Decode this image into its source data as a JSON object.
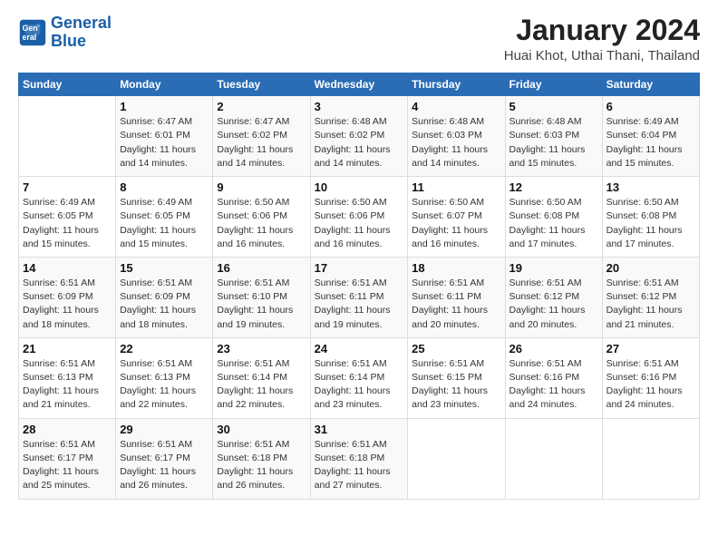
{
  "logo": {
    "line1": "General",
    "line2": "Blue"
  },
  "title": "January 2024",
  "subtitle": "Huai Khot, Uthai Thani, Thailand",
  "weekdays": [
    "Sunday",
    "Monday",
    "Tuesday",
    "Wednesday",
    "Thursday",
    "Friday",
    "Saturday"
  ],
  "weeks": [
    [
      {
        "day": "",
        "info": ""
      },
      {
        "day": "1",
        "info": "Sunrise: 6:47 AM\nSunset: 6:01 PM\nDaylight: 11 hours\nand 14 minutes."
      },
      {
        "day": "2",
        "info": "Sunrise: 6:47 AM\nSunset: 6:02 PM\nDaylight: 11 hours\nand 14 minutes."
      },
      {
        "day": "3",
        "info": "Sunrise: 6:48 AM\nSunset: 6:02 PM\nDaylight: 11 hours\nand 14 minutes."
      },
      {
        "day": "4",
        "info": "Sunrise: 6:48 AM\nSunset: 6:03 PM\nDaylight: 11 hours\nand 14 minutes."
      },
      {
        "day": "5",
        "info": "Sunrise: 6:48 AM\nSunset: 6:03 PM\nDaylight: 11 hours\nand 15 minutes."
      },
      {
        "day": "6",
        "info": "Sunrise: 6:49 AM\nSunset: 6:04 PM\nDaylight: 11 hours\nand 15 minutes."
      }
    ],
    [
      {
        "day": "7",
        "info": "Sunrise: 6:49 AM\nSunset: 6:05 PM\nDaylight: 11 hours\nand 15 minutes."
      },
      {
        "day": "8",
        "info": "Sunrise: 6:49 AM\nSunset: 6:05 PM\nDaylight: 11 hours\nand 15 minutes."
      },
      {
        "day": "9",
        "info": "Sunrise: 6:50 AM\nSunset: 6:06 PM\nDaylight: 11 hours\nand 16 minutes."
      },
      {
        "day": "10",
        "info": "Sunrise: 6:50 AM\nSunset: 6:06 PM\nDaylight: 11 hours\nand 16 minutes."
      },
      {
        "day": "11",
        "info": "Sunrise: 6:50 AM\nSunset: 6:07 PM\nDaylight: 11 hours\nand 16 minutes."
      },
      {
        "day": "12",
        "info": "Sunrise: 6:50 AM\nSunset: 6:08 PM\nDaylight: 11 hours\nand 17 minutes."
      },
      {
        "day": "13",
        "info": "Sunrise: 6:50 AM\nSunset: 6:08 PM\nDaylight: 11 hours\nand 17 minutes."
      }
    ],
    [
      {
        "day": "14",
        "info": "Sunrise: 6:51 AM\nSunset: 6:09 PM\nDaylight: 11 hours\nand 18 minutes."
      },
      {
        "day": "15",
        "info": "Sunrise: 6:51 AM\nSunset: 6:09 PM\nDaylight: 11 hours\nand 18 minutes."
      },
      {
        "day": "16",
        "info": "Sunrise: 6:51 AM\nSunset: 6:10 PM\nDaylight: 11 hours\nand 19 minutes."
      },
      {
        "day": "17",
        "info": "Sunrise: 6:51 AM\nSunset: 6:11 PM\nDaylight: 11 hours\nand 19 minutes."
      },
      {
        "day": "18",
        "info": "Sunrise: 6:51 AM\nSunset: 6:11 PM\nDaylight: 11 hours\nand 20 minutes."
      },
      {
        "day": "19",
        "info": "Sunrise: 6:51 AM\nSunset: 6:12 PM\nDaylight: 11 hours\nand 20 minutes."
      },
      {
        "day": "20",
        "info": "Sunrise: 6:51 AM\nSunset: 6:12 PM\nDaylight: 11 hours\nand 21 minutes."
      }
    ],
    [
      {
        "day": "21",
        "info": "Sunrise: 6:51 AM\nSunset: 6:13 PM\nDaylight: 11 hours\nand 21 minutes."
      },
      {
        "day": "22",
        "info": "Sunrise: 6:51 AM\nSunset: 6:13 PM\nDaylight: 11 hours\nand 22 minutes."
      },
      {
        "day": "23",
        "info": "Sunrise: 6:51 AM\nSunset: 6:14 PM\nDaylight: 11 hours\nand 22 minutes."
      },
      {
        "day": "24",
        "info": "Sunrise: 6:51 AM\nSunset: 6:14 PM\nDaylight: 11 hours\nand 23 minutes."
      },
      {
        "day": "25",
        "info": "Sunrise: 6:51 AM\nSunset: 6:15 PM\nDaylight: 11 hours\nand 23 minutes."
      },
      {
        "day": "26",
        "info": "Sunrise: 6:51 AM\nSunset: 6:16 PM\nDaylight: 11 hours\nand 24 minutes."
      },
      {
        "day": "27",
        "info": "Sunrise: 6:51 AM\nSunset: 6:16 PM\nDaylight: 11 hours\nand 24 minutes."
      }
    ],
    [
      {
        "day": "28",
        "info": "Sunrise: 6:51 AM\nSunset: 6:17 PM\nDaylight: 11 hours\nand 25 minutes."
      },
      {
        "day": "29",
        "info": "Sunrise: 6:51 AM\nSunset: 6:17 PM\nDaylight: 11 hours\nand 26 minutes."
      },
      {
        "day": "30",
        "info": "Sunrise: 6:51 AM\nSunset: 6:18 PM\nDaylight: 11 hours\nand 26 minutes."
      },
      {
        "day": "31",
        "info": "Sunrise: 6:51 AM\nSunset: 6:18 PM\nDaylight: 11 hours\nand 27 minutes."
      },
      {
        "day": "",
        "info": ""
      },
      {
        "day": "",
        "info": ""
      },
      {
        "day": "",
        "info": ""
      }
    ]
  ]
}
